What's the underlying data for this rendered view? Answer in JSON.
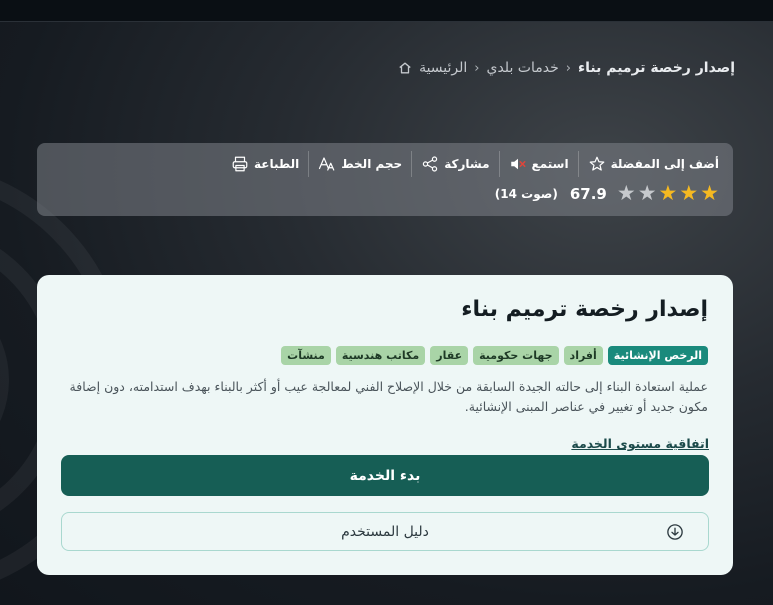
{
  "breadcrumb": {
    "home": "الرئيسية",
    "section": "خدمات بلدي",
    "current": "إصدار رخصة ترميم بناء"
  },
  "toolbar": {
    "favorite": "أضف إلى المفضلة",
    "listen": "استمع",
    "share": "مشاركة",
    "font_size": "حجم الخط",
    "print": "الطباعة"
  },
  "rating": {
    "stars_filled": 3,
    "stars_total": 5,
    "score": "67.9",
    "votes": "(14 صوت)",
    "colors": {
      "on": "#f5b921",
      "off": "#c6c9cd"
    }
  },
  "service": {
    "title": "إصدار رخصة ترميم بناء",
    "tags": [
      "الرخص الإنشائية",
      "أفراد",
      "جهات حكومية",
      "عقار",
      "مكاتب هندسية",
      "منشآت"
    ],
    "description": "عملية استعادة البناء إلى حالته الجيدة السابقة من خلال الإصلاح الفني لمعالجة عيب أو أكثر بالبناء بهدف استدامته، دون إضافة مكون جديد أو تغيير في عناصر المبنى الإنشائية.",
    "sla_link": "اتفاقية مستوى الخدمة",
    "start_button": "بدء الخدمة",
    "guide_button": "دليل المستخدم"
  },
  "colors": {
    "primary": "#165e55",
    "tag_primary": "#1a8a7c",
    "tag": "#a9d4a7"
  },
  "icons": {
    "home": "home-icon",
    "favorite": "star-outline-icon",
    "listen": "speaker-muted-icon",
    "share": "share-icon",
    "font_size": "font-size-icon",
    "print": "printer-icon",
    "guide": "download-circle-icon"
  }
}
